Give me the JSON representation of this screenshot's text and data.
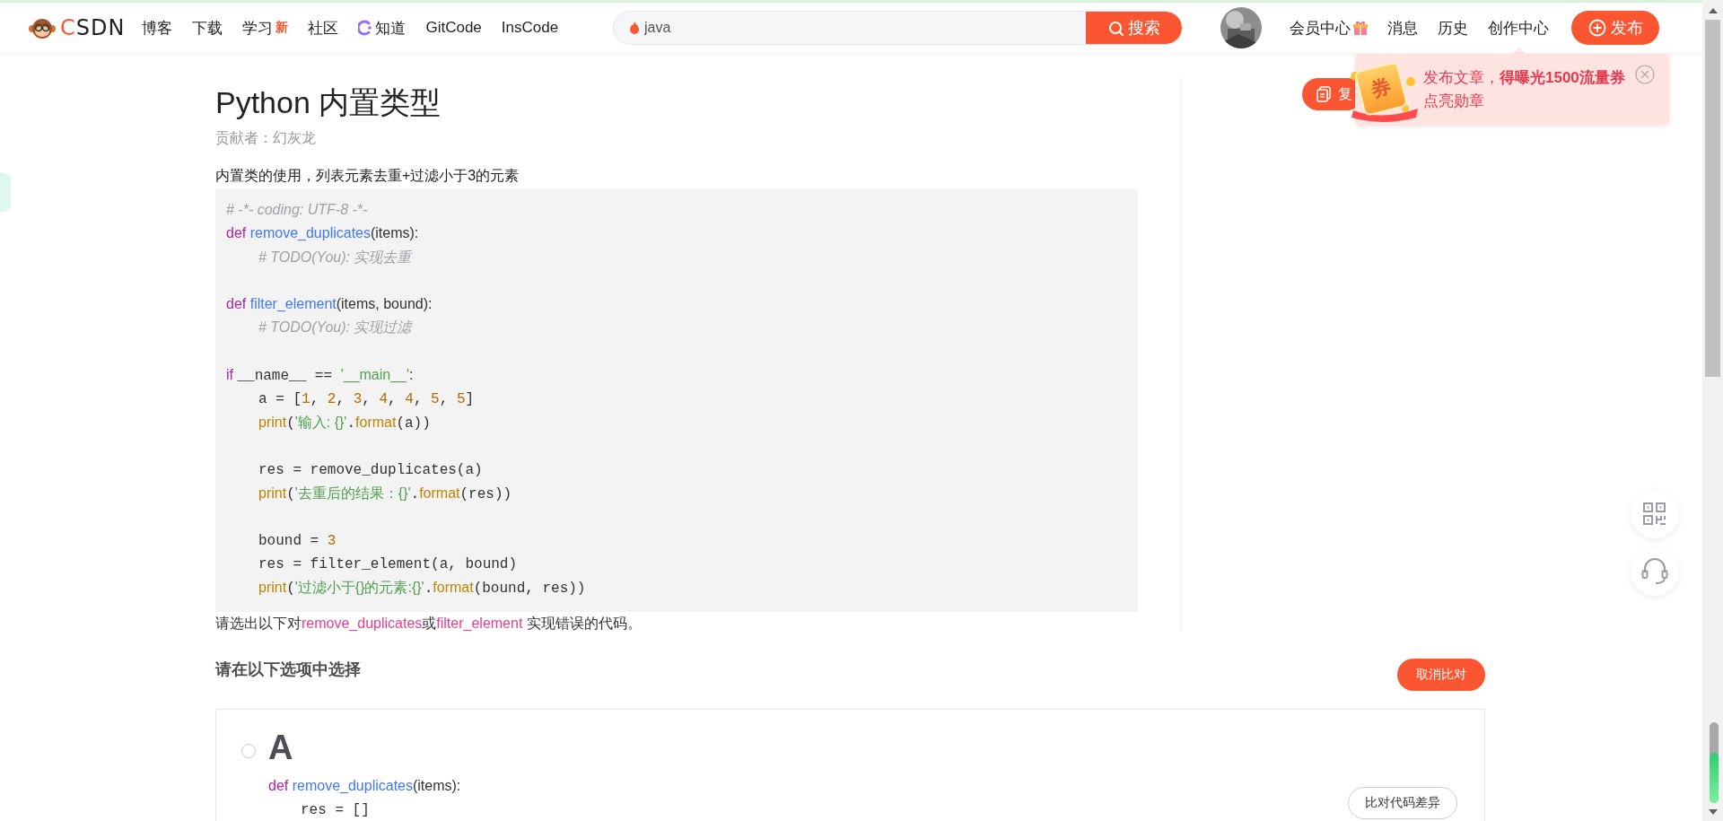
{
  "header": {
    "logo": "CSDN",
    "nav": [
      {
        "label": "博客",
        "kind": "plain"
      },
      {
        "label": "下载",
        "kind": "plain"
      },
      {
        "label": "学习",
        "kind": "badge",
        "badge": "新"
      },
      {
        "label": "社区",
        "kind": "plain"
      },
      {
        "label": "知道",
        "kind": "icon"
      },
      {
        "label": "GitCode",
        "kind": "plain"
      },
      {
        "label": "InsCode",
        "kind": "plain"
      }
    ],
    "search": {
      "value": "java",
      "button": "搜索"
    },
    "links": [
      {
        "label": "会员中心",
        "kind": "gift"
      },
      {
        "label": "消息",
        "kind": "plain"
      },
      {
        "label": "历史",
        "kind": "plain"
      },
      {
        "label": "创作中心",
        "kind": "plain"
      }
    ],
    "publish": "发布"
  },
  "article": {
    "title": "Python 内置类型",
    "contributor": "贡献者：幻灰龙",
    "description": "内置类的使用，列表元素去重+过滤小于3的元素",
    "code": [
      {
        "kind": "code",
        "indented": false,
        "tokens": [
          {
            "t": "# -*- coding: UTF-8 -*-",
            "kind": "c"
          }
        ]
      },
      {
        "kind": "code",
        "indented": false,
        "tokens": [
          {
            "t": "def ",
            "kind": "kw"
          },
          {
            "t": "remove_duplicates",
            "kind": "fn"
          },
          {
            "t": "(items):",
            "kind": "p"
          }
        ]
      },
      {
        "kind": "code",
        "indented": true,
        "tokens": [
          {
            "t": "# TODO(You): 实现去重",
            "kind": "c"
          }
        ]
      },
      {
        "kind": "blank"
      },
      {
        "kind": "code",
        "indented": false,
        "tokens": [
          {
            "t": "def ",
            "kind": "kw"
          },
          {
            "t": "filter_element",
            "kind": "fn"
          },
          {
            "t": "(items, bound):",
            "kind": "p"
          }
        ]
      },
      {
        "kind": "code",
        "indented": true,
        "tokens": [
          {
            "t": "# TODO(You): 实现过滤",
            "kind": "c"
          }
        ]
      },
      {
        "kind": "blank"
      },
      {
        "kind": "code",
        "indented": false,
        "tokens": [
          {
            "t": "if ",
            "kind": "kw"
          },
          {
            "t": "__name__ == ",
            "kind": "m"
          },
          {
            "t": "'__main__'",
            "kind": "s"
          },
          {
            "t": ":",
            "kind": "p"
          }
        ]
      },
      {
        "kind": "code",
        "indented": true,
        "tokens": [
          {
            "t": "a = [",
            "kind": "m"
          },
          {
            "t": "1",
            "kind": "n"
          },
          {
            "t": ", ",
            "kind": "m"
          },
          {
            "t": "2",
            "kind": "n"
          },
          {
            "t": ", ",
            "kind": "m"
          },
          {
            "t": "3",
            "kind": "n"
          },
          {
            "t": ", ",
            "kind": "m"
          },
          {
            "t": "4",
            "kind": "n"
          },
          {
            "t": ", ",
            "kind": "m"
          },
          {
            "t": "4",
            "kind": "n"
          },
          {
            "t": ", ",
            "kind": "m"
          },
          {
            "t": "5",
            "kind": "n"
          },
          {
            "t": ", ",
            "kind": "m"
          },
          {
            "t": "5",
            "kind": "n"
          },
          {
            "t": "]",
            "kind": "m"
          }
        ]
      },
      {
        "kind": "code",
        "indented": true,
        "tokens": [
          {
            "t": "print",
            "kind": "b"
          },
          {
            "t": "(",
            "kind": "m"
          },
          {
            "t": "'输入: {}'",
            "kind": "s"
          },
          {
            "t": ".",
            "kind": "m"
          },
          {
            "t": "format",
            "kind": "b"
          },
          {
            "t": "(a))",
            "kind": "m"
          }
        ]
      },
      {
        "kind": "blank"
      },
      {
        "kind": "code",
        "indented": true,
        "tokens": [
          {
            "t": "res = remove_duplicates(a)",
            "kind": "m"
          }
        ]
      },
      {
        "kind": "code",
        "indented": true,
        "tokens": [
          {
            "t": "print",
            "kind": "b"
          },
          {
            "t": "(",
            "kind": "m"
          },
          {
            "t": "'去重后的结果：{}'",
            "kind": "s"
          },
          {
            "t": ".",
            "kind": "m"
          },
          {
            "t": "format",
            "kind": "b"
          },
          {
            "t": "(res))",
            "kind": "m"
          }
        ]
      },
      {
        "kind": "blank"
      },
      {
        "kind": "code",
        "indented": true,
        "tokens": [
          {
            "t": "bound = ",
            "kind": "m"
          },
          {
            "t": "3",
            "kind": "n"
          }
        ]
      },
      {
        "kind": "code",
        "indented": true,
        "tokens": [
          {
            "t": "res = filter_element(a, bound)",
            "kind": "m"
          }
        ]
      },
      {
        "kind": "code",
        "indented": true,
        "tokens": [
          {
            "t": "print",
            "kind": "b"
          },
          {
            "t": "(",
            "kind": "m"
          },
          {
            "t": "'过滤小于{}的元素:{}'",
            "kind": "s"
          },
          {
            "t": ".",
            "kind": "m"
          },
          {
            "t": "format",
            "kind": "b"
          },
          {
            "t": "(bound, res))",
            "kind": "m"
          }
        ]
      }
    ],
    "question": [
      {
        "t": "请选出以下对",
        "kind": "p"
      },
      {
        "t": "remove_duplicates",
        "kind": "hl"
      },
      {
        "t": "或",
        "kind": "p"
      },
      {
        "t": "filter_element",
        "kind": "hl"
      },
      {
        "t": " 实现错误的代码。",
        "kind": "p"
      }
    ]
  },
  "copy_button": "复",
  "promo": {
    "coupon": "券",
    "line1": "发布文章，",
    "line1_bold": "得曝光1500流量券",
    "line2": "点亮勋章"
  },
  "options": {
    "heading": "请在以下选项中选择",
    "cancel_compare": "取消比对",
    "items": [
      {
        "letter": "A",
        "selected": false,
        "compare": "比对代码差异",
        "code": [
          {
            "kind": "code",
            "indented": false,
            "tokens": [
              {
                "t": "def ",
                "kind": "kw"
              },
              {
                "t": "remove_duplicates",
                "kind": "fn"
              },
              {
                "t": "(items):",
                "kind": "p"
              }
            ]
          },
          {
            "kind": "code",
            "indented": true,
            "tokens": [
              {
                "t": "res = []",
                "kind": "m"
              }
            ]
          }
        ]
      }
    ]
  }
}
